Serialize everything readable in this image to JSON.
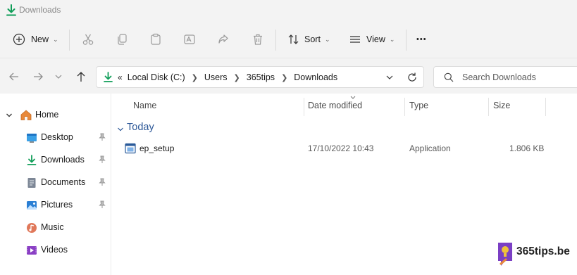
{
  "window": {
    "title": "Downloads"
  },
  "toolbar": {
    "new_label": "New",
    "sort_label": "Sort",
    "view_label": "View",
    "more_label": "•••"
  },
  "address": {
    "overflow": "«",
    "crumbs": [
      "Local Disk (C:)",
      "Users",
      "365tips",
      "Downloads"
    ]
  },
  "search": {
    "placeholder": "Search Downloads"
  },
  "sidebar": {
    "home": "Home",
    "items": [
      {
        "label": "Desktop",
        "icon": "desktop-icon",
        "pinned": true
      },
      {
        "label": "Downloads",
        "icon": "download-icon",
        "pinned": true
      },
      {
        "label": "Documents",
        "icon": "documents-icon",
        "pinned": true
      },
      {
        "label": "Pictures",
        "icon": "pictures-icon",
        "pinned": true
      },
      {
        "label": "Music",
        "icon": "music-icon",
        "pinned": false
      },
      {
        "label": "Videos",
        "icon": "videos-icon",
        "pinned": false
      }
    ]
  },
  "columns": {
    "name": "Name",
    "date": "Date modified",
    "type": "Type",
    "size": "Size"
  },
  "groups": [
    {
      "label": "Today",
      "files": [
        {
          "name": "ep_setup",
          "date": "17/10/2022 10:43",
          "type": "Application",
          "size": "1.806 KB"
        }
      ]
    }
  ],
  "watermark": {
    "text": "365tips.be"
  },
  "colors": {
    "accent": "#0f9d58",
    "folder_blue": "#2b5797",
    "chrome_bg": "#f3f3f3",
    "home_orange": "#e8893a",
    "brand_purple": "#7b3fc4"
  }
}
